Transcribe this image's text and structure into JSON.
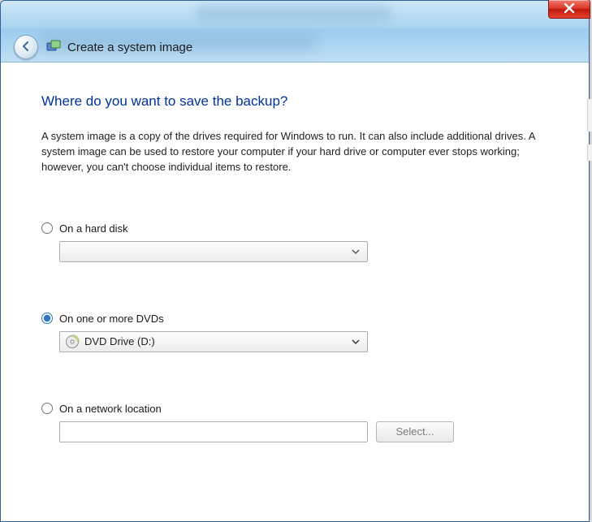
{
  "window": {
    "title": "Create a system image"
  },
  "wizard": {
    "heading": "Where do you want to save the backup?",
    "description": "A system image is a copy of the drives required for Windows to run. It can also include additional drives. A system image can be used to restore your computer if your hard drive or computer ever stops working; however, you can't choose individual items to restore."
  },
  "options": {
    "hard_disk": {
      "label": "On a hard disk",
      "selected": false,
      "dropdown_value": ""
    },
    "dvd": {
      "label": "On one or more DVDs",
      "selected": true,
      "dropdown_value": "DVD Drive (D:)"
    },
    "network": {
      "label": "On a network location",
      "selected": false,
      "path_value": "",
      "select_button": "Select..."
    }
  }
}
